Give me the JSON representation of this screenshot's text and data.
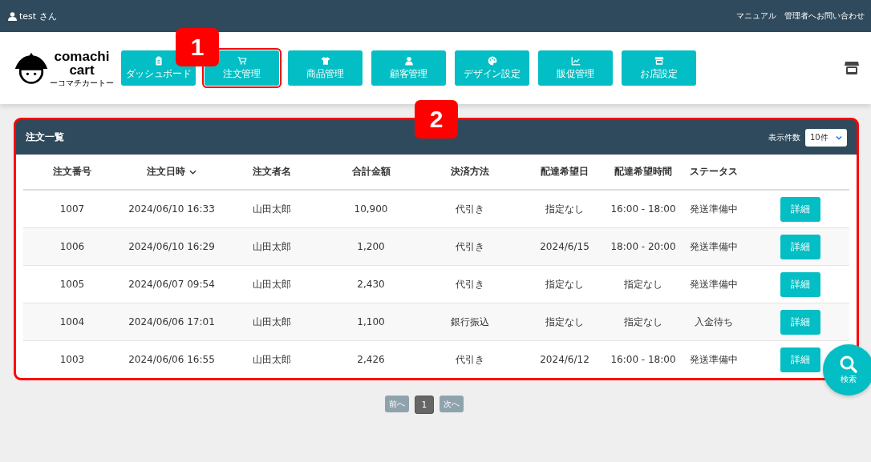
{
  "top_bar": {
    "user": "test さん",
    "links": [
      "マニュアル",
      "管理者へお問い合わせ"
    ]
  },
  "logo": {
    "name_line1": "comachi",
    "name_line2": "cart",
    "subtitle": "ーコマチカートー"
  },
  "nav": [
    {
      "label": "ダッシュボード",
      "outlined": false
    },
    {
      "label": "注文管理",
      "outlined": true,
      "callout": "1"
    },
    {
      "label": "商品管理",
      "outlined": false
    },
    {
      "label": "顧客管理",
      "outlined": false
    },
    {
      "label": "デザイン設定",
      "outlined": false
    },
    {
      "label": "販促管理",
      "outlined": false
    },
    {
      "label": "お店設定",
      "outlined": false
    }
  ],
  "panel": {
    "title": "注文一覧",
    "outlined": true,
    "callout": "2",
    "per_page_label": "表示件数",
    "per_page": "10件",
    "columns": [
      {
        "label": "注文番号",
        "sorted": false
      },
      {
        "label": "注文日時",
        "sorted": true
      },
      {
        "label": "注文者名",
        "sorted": false
      },
      {
        "label": "合計金額",
        "sorted": false
      },
      {
        "label": "決済方法",
        "sorted": false
      },
      {
        "label": "配達希望日",
        "sorted": false
      },
      {
        "label": "配達希望時間",
        "sorted": false
      },
      {
        "label": "ステータス",
        "sorted": false
      }
    ],
    "rows": [
      {
        "cells": [
          "1007",
          "2024/06/10 16:33",
          "山田太郎",
          "10,900",
          "代引き",
          "指定なし",
          "16:00 - 18:00",
          "発送準備中"
        ],
        "action": "詳細"
      },
      {
        "cells": [
          "1006",
          "2024/06/10 16:29",
          "山田太郎",
          "1,200",
          "代引き",
          "2024/6/15",
          "18:00 - 20:00",
          "発送準備中"
        ],
        "action": "詳細"
      },
      {
        "cells": [
          "1005",
          "2024/06/07 09:54",
          "山田太郎",
          "2,430",
          "代引き",
          "指定なし",
          "指定なし",
          "発送準備中"
        ],
        "action": "詳細"
      },
      {
        "cells": [
          "1004",
          "2024/06/06 17:01",
          "山田太郎",
          "1,100",
          "銀行振込",
          "指定なし",
          "指定なし",
          "入金待ち"
        ],
        "action": "詳細"
      },
      {
        "cells": [
          "1003",
          "2024/06/06 16:55",
          "山田太郎",
          "2,426",
          "代引き",
          "2024/6/12",
          "16:00 - 18:00",
          "発送準備中"
        ],
        "action": "詳細"
      }
    ]
  },
  "pagination": [
    {
      "label": "前へ",
      "selected": false
    },
    {
      "label": "1",
      "selected": true
    },
    {
      "label": "次へ",
      "selected": false
    }
  ],
  "search_button": {
    "label": "検索"
  }
}
